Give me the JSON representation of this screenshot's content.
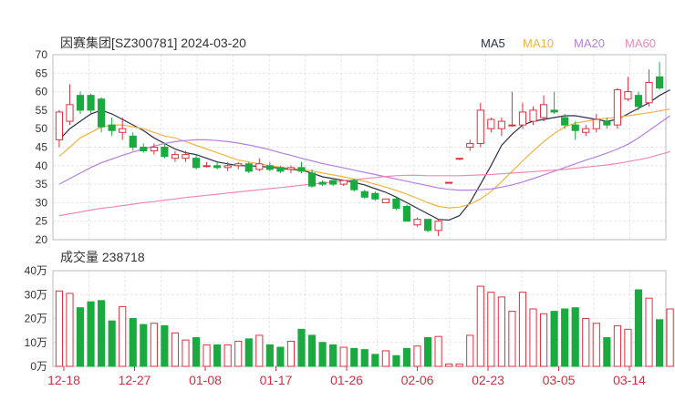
{
  "title": "因赛集团[SZ300781] 2024-03-20",
  "legend": [
    {
      "label": "MA5",
      "color": "#2b2f4a"
    },
    {
      "label": "MA10",
      "color": "#f2b441"
    },
    {
      "label": "MA20",
      "color": "#b57fe0"
    },
    {
      "label": "MA60",
      "color": "#f08ab4"
    }
  ],
  "volume_label": "成交量 238718",
  "colors": {
    "up": "#e03040",
    "down": "#1aaa40",
    "grid": "#e6e6e6",
    "axis_text": "#333333",
    "date_text": "#d03040"
  },
  "chart_data": [
    {
      "type": "candlestick",
      "ylim": [
        20,
        70
      ],
      "yticks": [
        20,
        25,
        30,
        35,
        40,
        45,
        50,
        55,
        60,
        65,
        70
      ],
      "candles": [
        {
          "o": 47,
          "h": 55,
          "l": 45,
          "c": 54.5
        },
        {
          "o": 52,
          "h": 62,
          "l": 51,
          "c": 56.5
        },
        {
          "o": 59,
          "h": 60,
          "l": 54,
          "c": 55
        },
        {
          "o": 59,
          "h": 59.5,
          "l": 54,
          "c": 55
        },
        {
          "o": 58,
          "h": 58.5,
          "l": 49,
          "c": 50.5
        },
        {
          "o": 51,
          "h": 53,
          "l": 48,
          "c": 49.5
        },
        {
          "o": 49,
          "h": 53,
          "l": 47,
          "c": 50
        },
        {
          "o": 48,
          "h": 49,
          "l": 44,
          "c": 45
        },
        {
          "o": 45,
          "h": 46,
          "l": 43.5,
          "c": 44
        },
        {
          "o": 44,
          "h": 46,
          "l": 43,
          "c": 45
        },
        {
          "o": 45,
          "h": 46,
          "l": 42,
          "c": 42.5
        },
        {
          "o": 42,
          "h": 44,
          "l": 41,
          "c": 43
        },
        {
          "o": 42,
          "h": 44,
          "l": 41,
          "c": 43
        },
        {
          "o": 42,
          "h": 43,
          "l": 39,
          "c": 39.5
        },
        {
          "o": 40,
          "h": 41,
          "l": 39.5,
          "c": 40
        },
        {
          "o": 40,
          "h": 41,
          "l": 39,
          "c": 39.5
        },
        {
          "o": 39.5,
          "h": 41,
          "l": 38.5,
          "c": 40
        },
        {
          "o": 40,
          "h": 41,
          "l": 39,
          "c": 40.5
        },
        {
          "o": 40.5,
          "h": 41,
          "l": 38,
          "c": 38.5
        },
        {
          "o": 39,
          "h": 42,
          "l": 38.5,
          "c": 40.5
        },
        {
          "o": 40,
          "h": 41,
          "l": 38.5,
          "c": 39
        },
        {
          "o": 39.5,
          "h": 40,
          "l": 38,
          "c": 38.5
        },
        {
          "o": 39,
          "h": 40,
          "l": 38,
          "c": 39.5
        },
        {
          "o": 39.5,
          "h": 41,
          "l": 38,
          "c": 38.5
        },
        {
          "o": 38,
          "h": 39,
          "l": 34,
          "c": 34.5
        },
        {
          "o": 35.5,
          "h": 36,
          "l": 34.5,
          "c": 35
        },
        {
          "o": 36,
          "h": 36.5,
          "l": 34.5,
          "c": 35
        },
        {
          "o": 35,
          "h": 36,
          "l": 34.5,
          "c": 36
        },
        {
          "o": 36,
          "h": 36.5,
          "l": 33,
          "c": 33.5
        },
        {
          "o": 33,
          "h": 33.5,
          "l": 31,
          "c": 31.5
        },
        {
          "o": 32.5,
          "h": 33,
          "l": 30.5,
          "c": 31
        },
        {
          "o": 30,
          "h": 31,
          "l": 30,
          "c": 31
        },
        {
          "o": 31,
          "h": 31.5,
          "l": 28,
          "c": 28.5
        },
        {
          "o": 29,
          "h": 29.5,
          "l": 25,
          "c": 25
        },
        {
          "o": 24,
          "h": 26,
          "l": 23.5,
          "c": 25.5
        },
        {
          "o": 25.5,
          "h": 25.5,
          "l": 22,
          "c": 22.5
        },
        {
          "o": 22.5,
          "h": 25.5,
          "l": 21,
          "c": 25
        },
        {
          "o": 35.5,
          "h": 35.5,
          "l": 35.5,
          "c": 35.5
        },
        {
          "o": 42,
          "h": 42,
          "l": 41.5,
          "c": 42
        },
        {
          "o": 45,
          "h": 47,
          "l": 44,
          "c": 46
        },
        {
          "o": 46,
          "h": 57,
          "l": 45,
          "c": 55
        },
        {
          "o": 50,
          "h": 53,
          "l": 49,
          "c": 52.5
        },
        {
          "o": 50,
          "h": 53,
          "l": 48,
          "c": 52
        },
        {
          "o": 51,
          "h": 60,
          "l": 50.5,
          "c": 51
        },
        {
          "o": 51,
          "h": 57,
          "l": 50,
          "c": 54.5
        },
        {
          "o": 52,
          "h": 56,
          "l": 51,
          "c": 55
        },
        {
          "o": 53,
          "h": 59,
          "l": 52,
          "c": 56.5
        },
        {
          "o": 55,
          "h": 60,
          "l": 54,
          "c": 54.5
        },
        {
          "o": 53,
          "h": 54,
          "l": 50,
          "c": 51
        },
        {
          "o": 51,
          "h": 52,
          "l": 47,
          "c": 49.5
        },
        {
          "o": 49,
          "h": 51,
          "l": 48,
          "c": 50
        },
        {
          "o": 50,
          "h": 54,
          "l": 49,
          "c": 52.5
        },
        {
          "o": 52,
          "h": 53,
          "l": 50,
          "c": 51
        },
        {
          "o": 51,
          "h": 61,
          "l": 50,
          "c": 60.5
        },
        {
          "o": 58,
          "h": 64,
          "l": 57.5,
          "c": 60
        },
        {
          "o": 59,
          "h": 60,
          "l": 55,
          "c": 56
        },
        {
          "o": 57,
          "h": 66,
          "l": 56,
          "c": 62.5
        },
        {
          "o": 64,
          "h": 68,
          "l": 60.5,
          "c": 61
        }
      ],
      "ma": {
        "MA5": [
          47,
          50,
          52,
          54,
          55,
          54,
          52.5,
          51,
          49.5,
          47.5,
          46,
          44.5,
          43.5,
          43,
          42,
          41,
          40.5,
          40,
          40,
          39.8,
          39.6,
          39.3,
          39,
          38.8,
          38,
          37,
          36.5,
          36,
          35.5,
          34.8,
          33.8,
          32.8,
          31.5,
          30,
          28.5,
          27,
          25.5,
          25.3,
          26.5,
          30,
          35,
          40,
          45.5,
          48.5,
          51,
          52,
          52.5,
          53,
          53.5,
          53.5,
          53,
          52.5,
          52,
          52.5,
          54,
          55.5,
          57,
          59,
          60.5
        ],
        "MA10": [
          42.5,
          45,
          47.5,
          49,
          50.5,
          51,
          51,
          50.5,
          50,
          49,
          48,
          47.5,
          46.5,
          45.5,
          44.5,
          43.5,
          42.5,
          41.5,
          41,
          40.5,
          40,
          39.6,
          39.3,
          39,
          38.6,
          38,
          37.5,
          37,
          36.4,
          35.8,
          35,
          34.2,
          33.3,
          32.3,
          31.2,
          30,
          29,
          28.6,
          28.8,
          29.6,
          31,
          33,
          35.7,
          38.5,
          41.3,
          44,
          46.5,
          48.7,
          50.5,
          51.5,
          52,
          52.5,
          52.8,
          53.1,
          53.5,
          53.9,
          54.3,
          54.8,
          55.3
        ],
        "MA20": [
          35,
          36.5,
          38,
          39.5,
          40.8,
          41.8,
          42.8,
          43.7,
          44.5,
          45.3,
          46,
          46.5,
          46.8,
          47,
          47,
          46.8,
          46.5,
          46.1,
          45.6,
          45,
          44.3,
          43.5,
          42.8,
          42,
          41.3,
          40.6,
          40,
          39.4,
          38.8,
          38.2,
          37.6,
          37,
          36.4,
          35.8,
          35.2,
          34.6,
          34,
          33.6,
          33.4,
          33.4,
          33.5,
          33.7,
          34.2,
          34.8,
          35.6,
          36.5,
          37.5,
          38.5,
          39.5,
          40.5,
          41.5,
          42.4,
          43.4,
          44.5,
          45.8,
          47.5,
          49.5,
          51.5,
          53.5
        ],
        "MA60": [
          26.5,
          27,
          27.5,
          28,
          28.5,
          28.8,
          29.2,
          29.6,
          30,
          30.3,
          30.7,
          31,
          31.4,
          31.7,
          32,
          32.3,
          32.6,
          32.9,
          33.2,
          33.5,
          33.8,
          34.1,
          34.4,
          34.7,
          35,
          35.3,
          35.6,
          35.9,
          36.2,
          36.5,
          36.8,
          37.1,
          37.3,
          37.4,
          37.4,
          37.3,
          37.3,
          37.3,
          37.3,
          37.4,
          37.5,
          37.6,
          37.8,
          38,
          38.2,
          38.4,
          38.6,
          38.8,
          39,
          39.3,
          39.6,
          39.9,
          40.2,
          40.6,
          41.1,
          41.6,
          42.2,
          43,
          43.8
        ]
      }
    },
    {
      "type": "bar",
      "series_name": "成交量",
      "ylim": [
        0,
        40
      ],
      "yticks": [
        "0万",
        "10万",
        "20万",
        "30万",
        "40万"
      ],
      "values": [
        31.5,
        30.5,
        24.5,
        27,
        27.5,
        19,
        25,
        20,
        17.5,
        18,
        17,
        14,
        11,
        12,
        9,
        9,
        9,
        10.5,
        11.5,
        13,
        9,
        8,
        10.5,
        15.5,
        13,
        10,
        9,
        8,
        7.5,
        7,
        5,
        6.5,
        4.5,
        7.5,
        8.5,
        12,
        12.5,
        1,
        1,
        13,
        33.5,
        31,
        29,
        23,
        31,
        24,
        22,
        23,
        24,
        24.5,
        20,
        18,
        12,
        17,
        15.5,
        32,
        28.5,
        19.5,
        24,
        24
      ]
    }
  ],
  "x_dates": [
    "12-18",
    "12-27",
    "01-08",
    "01-17",
    "01-26",
    "02-06",
    "02-23",
    "03-05",
    "03-14"
  ]
}
